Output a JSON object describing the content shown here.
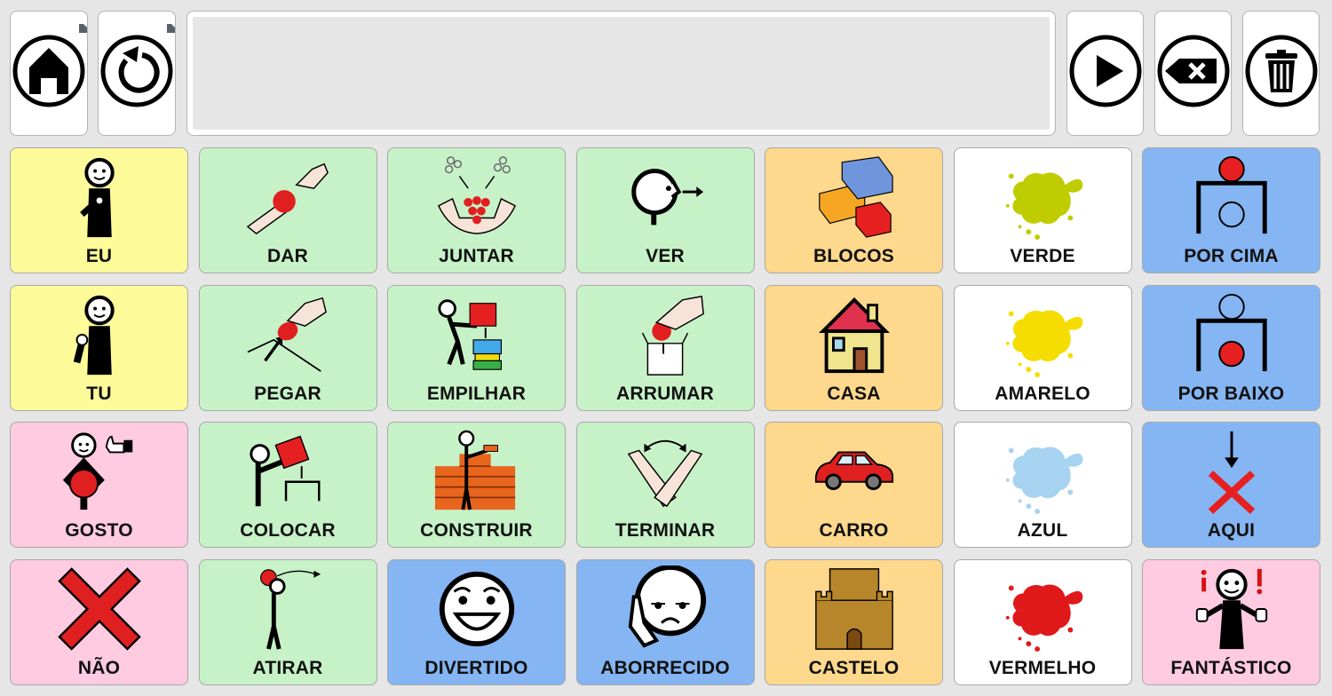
{
  "toolbar": {
    "left": [
      {
        "id": "home",
        "icon": "home-icon",
        "has_corner_marker": true
      },
      {
        "id": "back",
        "icon": "undo-icon",
        "has_corner_marker": true
      }
    ],
    "message_bar": {
      "text": ""
    },
    "right": [
      {
        "id": "speak",
        "icon": "play-icon"
      },
      {
        "id": "backspace",
        "icon": "backspace-icon"
      },
      {
        "id": "clear",
        "icon": "trash-icon"
      }
    ]
  },
  "colors": {
    "yellow": "#fdfa9a",
    "green": "#c7f2c8",
    "orange": "#fed88c",
    "white": "#ffffff",
    "blue": "#85b5f2",
    "pink": "#fecbe0"
  },
  "grid": {
    "rows": [
      [
        {
          "label": "EU",
          "color": "yellow",
          "icon": "person-me-icon"
        },
        {
          "label": "DAR",
          "color": "green",
          "icon": "give-icon"
        },
        {
          "label": "JUNTAR",
          "color": "green",
          "icon": "gather-icon"
        },
        {
          "label": "VER",
          "color": "green",
          "icon": "see-icon"
        },
        {
          "label": "BLOCOS",
          "color": "orange",
          "icon": "blocks-icon"
        },
        {
          "label": "VERDE",
          "color": "white",
          "icon": "green-splash-icon",
          "splash": "#bfcc00"
        },
        {
          "label": "POR CIMA",
          "color": "blue",
          "icon": "on-top-icon"
        }
      ],
      [
        {
          "label": "TU",
          "color": "yellow",
          "icon": "person-you-icon"
        },
        {
          "label": "PEGAR",
          "color": "green",
          "icon": "pick-up-icon"
        },
        {
          "label": "EMPILHAR",
          "color": "green",
          "icon": "stack-icon"
        },
        {
          "label": "ARRUMAR",
          "color": "green",
          "icon": "put-away-icon"
        },
        {
          "label": "CASA",
          "color": "orange",
          "icon": "house-icon"
        },
        {
          "label": "AMARELO",
          "color": "white",
          "icon": "yellow-splash-icon",
          "splash": "#f5dd00"
        },
        {
          "label": "POR BAIXO",
          "color": "blue",
          "icon": "under-icon"
        }
      ],
      [
        {
          "label": "GOSTO",
          "color": "pink",
          "icon": "like-icon"
        },
        {
          "label": "COLOCAR",
          "color": "green",
          "icon": "place-icon"
        },
        {
          "label": "CONSTRUIR",
          "color": "green",
          "icon": "build-icon"
        },
        {
          "label": "TERMINAR",
          "color": "green",
          "icon": "finish-icon"
        },
        {
          "label": "CARRO",
          "color": "orange",
          "icon": "car-icon"
        },
        {
          "label": "AZUL",
          "color": "white",
          "icon": "blue-splash-icon",
          "splash": "#a6d3ef"
        },
        {
          "label": "AQUI",
          "color": "blue",
          "icon": "here-icon"
        }
      ],
      [
        {
          "label": "NÃO",
          "color": "pink",
          "icon": "no-icon"
        },
        {
          "label": "ATIRAR",
          "color": "green",
          "icon": "throw-icon"
        },
        {
          "label": "DIVERTIDO",
          "color": "blue",
          "icon": "fun-face-icon"
        },
        {
          "label": "ABORRECIDO",
          "color": "blue",
          "icon": "bored-face-icon"
        },
        {
          "label": "CASTELO",
          "color": "orange",
          "icon": "castle-icon"
        },
        {
          "label": "VERMELHO",
          "color": "white",
          "icon": "red-splash-icon",
          "splash": "#e01a1a"
        },
        {
          "label": "FANTÁSTICO",
          "color": "pink",
          "icon": "fantastic-icon"
        }
      ]
    ]
  }
}
